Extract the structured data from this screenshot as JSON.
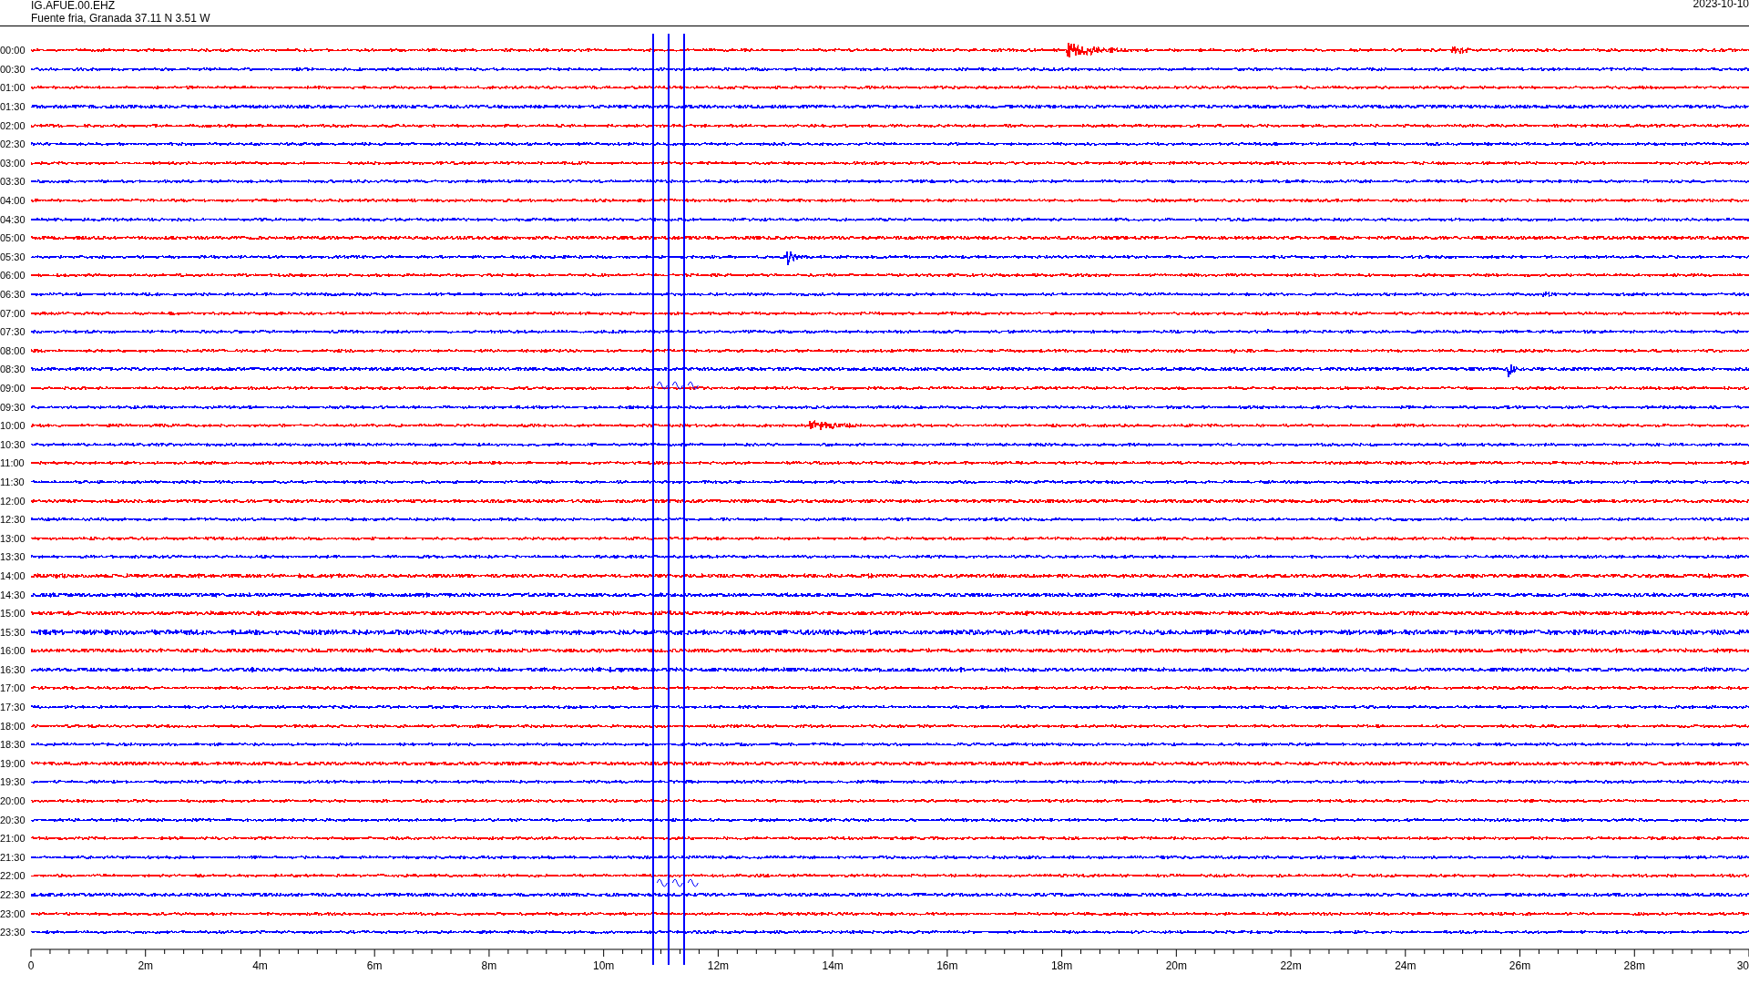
{
  "header": {
    "station": "IG.AFUE.00.EHZ",
    "location": "Fuente fria, Granada  37.11 N 3.51 W",
    "date": "2023-10-10"
  },
  "rows": [
    {
      "time": "00:00",
      "color": "#ff0000"
    },
    {
      "time": "00:30",
      "color": "#0000ff"
    },
    {
      "time": "01:00",
      "color": "#ff0000"
    },
    {
      "time": "01:30",
      "color": "#0000ff"
    },
    {
      "time": "02:00",
      "color": "#ff0000"
    },
    {
      "time": "02:30",
      "color": "#0000ff"
    },
    {
      "time": "03:00",
      "color": "#ff0000"
    },
    {
      "time": "03:30",
      "color": "#0000ff"
    },
    {
      "time": "04:00",
      "color": "#ff0000"
    },
    {
      "time": "04:30",
      "color": "#0000ff"
    },
    {
      "time": "05:00",
      "color": "#ff0000"
    },
    {
      "time": "05:30",
      "color": "#0000ff"
    },
    {
      "time": "06:00",
      "color": "#ff0000"
    },
    {
      "time": "06:30",
      "color": "#0000ff"
    },
    {
      "time": "07:00",
      "color": "#ff0000"
    },
    {
      "time": "07:30",
      "color": "#0000ff"
    },
    {
      "time": "08:00",
      "color": "#ff0000"
    },
    {
      "time": "08:30",
      "color": "#0000ff"
    },
    {
      "time": "09:00",
      "color": "#ff0000"
    },
    {
      "time": "09:30",
      "color": "#0000ff"
    },
    {
      "time": "10:00",
      "color": "#ff0000"
    },
    {
      "time": "10:30",
      "color": "#0000ff"
    },
    {
      "time": "11:00",
      "color": "#ff0000"
    },
    {
      "time": "11:30",
      "color": "#0000ff"
    },
    {
      "time": "12:00",
      "color": "#ff0000"
    },
    {
      "time": "12:30",
      "color": "#0000ff"
    },
    {
      "time": "13:00",
      "color": "#ff0000"
    },
    {
      "time": "13:30",
      "color": "#0000ff"
    },
    {
      "time": "14:00",
      "color": "#ff0000"
    },
    {
      "time": "14:30",
      "color": "#0000ff"
    },
    {
      "time": "15:00",
      "color": "#ff0000"
    },
    {
      "time": "15:30",
      "color": "#0000ff"
    },
    {
      "time": "16:00",
      "color": "#ff0000"
    },
    {
      "time": "16:30",
      "color": "#0000ff"
    },
    {
      "time": "17:00",
      "color": "#ff0000"
    },
    {
      "time": "17:30",
      "color": "#0000ff"
    },
    {
      "time": "18:00",
      "color": "#ff0000"
    },
    {
      "time": "18:30",
      "color": "#0000ff"
    },
    {
      "time": "19:00",
      "color": "#ff0000"
    },
    {
      "time": "19:30",
      "color": "#0000ff"
    },
    {
      "time": "20:00",
      "color": "#ff0000"
    },
    {
      "time": "20:30",
      "color": "#0000ff"
    },
    {
      "time": "21:00",
      "color": "#ff0000"
    },
    {
      "time": "21:30",
      "color": "#0000ff"
    },
    {
      "time": "22:00",
      "color": "#ff0000"
    },
    {
      "time": "22:30",
      "color": "#0000ff"
    },
    {
      "time": "23:00",
      "color": "#ff0000"
    },
    {
      "time": "23:30",
      "color": "#0000ff"
    }
  ],
  "axis": {
    "labels": [
      "0",
      "2m",
      "4m",
      "6m",
      "8m",
      "10m",
      "12m",
      "14m",
      "16m",
      "18m",
      "20m",
      "22m",
      "24m",
      "26m",
      "28m",
      "30"
    ]
  }
}
